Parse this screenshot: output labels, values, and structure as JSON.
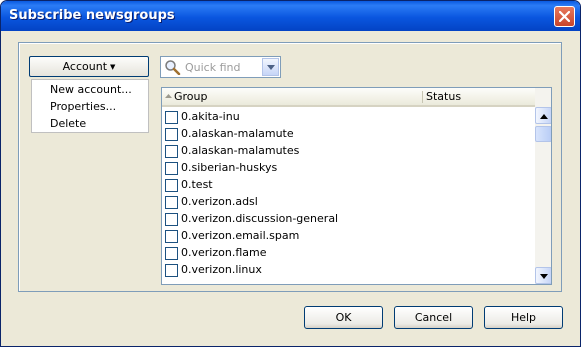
{
  "window": {
    "title": "Subscribe newsgroups"
  },
  "account_button": {
    "label": "Account"
  },
  "account_menu": {
    "items": [
      "New account...",
      "Properties...",
      "Delete"
    ]
  },
  "search": {
    "placeholder": "Quick find"
  },
  "listview": {
    "columns": [
      "Group",
      "Status"
    ],
    "sort_column": "Group",
    "rows": [
      "0.akita-inu",
      "0.alaskan-malamute",
      "0.alaskan-malamutes",
      "0.siberian-huskys",
      "0.test",
      "0.verizon.adsl",
      "0.verizon.discussion-general",
      "0.verizon.email.spam",
      "0.verizon.flame",
      "0.verizon.linux"
    ]
  },
  "buttons": {
    "ok": "OK",
    "cancel": "Cancel",
    "help": "Help"
  }
}
